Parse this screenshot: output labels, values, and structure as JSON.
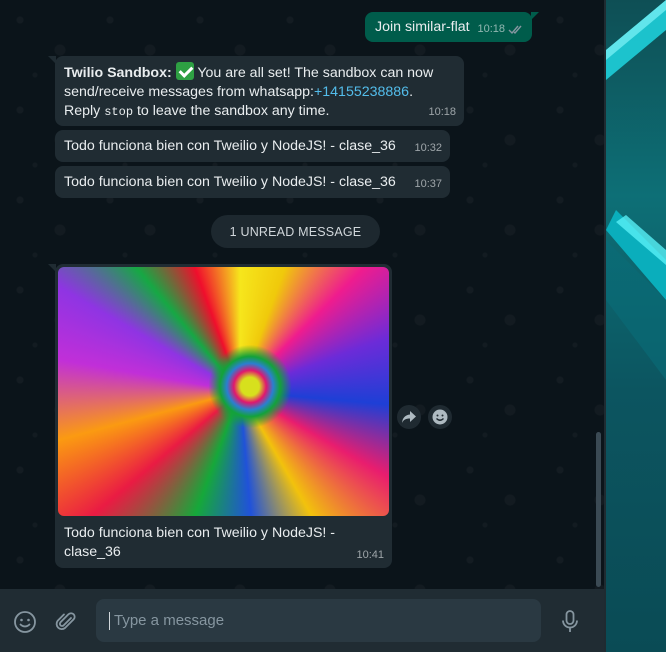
{
  "messages": {
    "join": {
      "text": "Join similar-flat",
      "time": "10:18"
    },
    "sandbox": {
      "sender": "Twilio Sandbox:",
      "line1_rest": " You are all set! The sandbox can now",
      "line2_prefix": "send/receive messages from whatsapp:",
      "phone": "+14155238886",
      "line2_suffix": ".",
      "line3_prefix": "Reply ",
      "stop_word": "stop",
      "line3_suffix": " to leave the sandbox any time.",
      "time": "10:18"
    },
    "msg1": {
      "text": "Todo funciona bien con Tweilio y NodeJS! - clase_36",
      "time": "10:32"
    },
    "msg2": {
      "text": "Todo funciona bien con Tweilio y NodeJS! - clase_36",
      "time": "10:37"
    },
    "unread_label": "1 UNREAD MESSAGE",
    "image_msg": {
      "caption_line1": "Todo funciona bien con Tweilio y NodeJS! -",
      "caption_line2": "clase_36",
      "time": "10:41"
    }
  },
  "footer": {
    "placeholder": "Type a message",
    "icons": [
      "emoji-icon",
      "attach-icon",
      "mic-icon"
    ]
  },
  "colors": {
    "outgoing_bubble": "#005c4b",
    "incoming_bubble": "#202c33",
    "link": "#53bdeb",
    "background": "#0b141a"
  }
}
